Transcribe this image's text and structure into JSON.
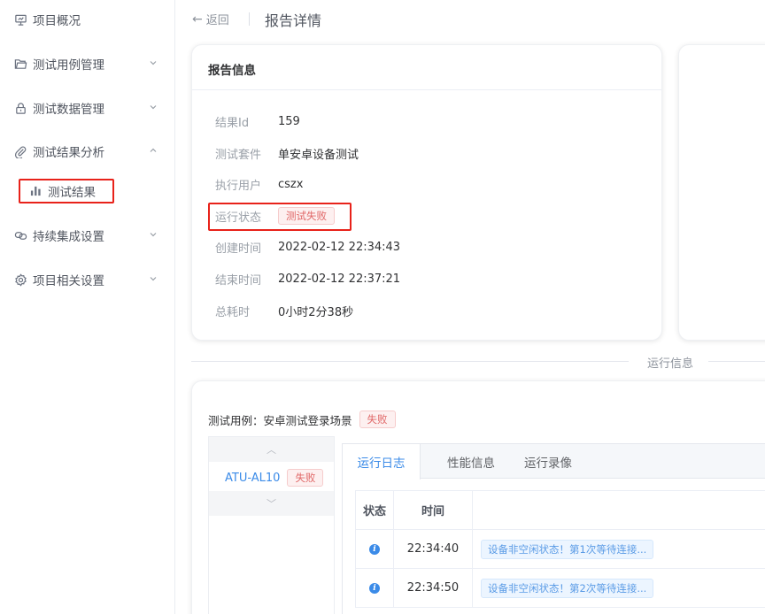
{
  "sidebar": {
    "items": [
      {
        "label": "项目概况",
        "icon": "presentation-icon"
      },
      {
        "label": "测试用例管理",
        "icon": "folder-icon"
      },
      {
        "label": "测试数据管理",
        "icon": "lock-icon"
      },
      {
        "label": "测试结果分析",
        "icon": "paperclip-icon"
      },
      {
        "label": "持续集成设置",
        "icon": "link-icon"
      },
      {
        "label": "项目相关设置",
        "icon": "gear-icon"
      }
    ],
    "sub_item": {
      "label": "测试结果",
      "icon": "bar-chart-icon"
    }
  },
  "header": {
    "back_label": "返回",
    "title": "报告详情"
  },
  "report": {
    "title": "报告信息",
    "fields": {
      "result_id": {
        "label": "结果Id",
        "value": "159"
      },
      "suite": {
        "label": "测试套件",
        "value": "单安卓设备测试"
      },
      "user": {
        "label": "执行用户",
        "value": "cszx"
      },
      "status": {
        "label": "运行状态",
        "value": "测试失败"
      },
      "created": {
        "label": "创建时间",
        "value": "2022-02-12 22:34:43"
      },
      "ended": {
        "label": "结束时间",
        "value": "2022-02-12 22:37:21"
      },
      "duration": {
        "label": "总耗时",
        "value": "0小时2分38秒"
      }
    }
  },
  "run_info": {
    "label": "运行信息",
    "case_title": "测试用例：安卓测试登录场景",
    "case_status": "失败",
    "device": {
      "name": "ATU-AL10",
      "status": "失败"
    },
    "tabs": [
      "运行日志",
      "性能信息",
      "运行录像"
    ],
    "active_tab": "运行日志",
    "table": {
      "headers": [
        "状态",
        "时间",
        ""
      ],
      "rows": [
        {
          "status_icon": "info-icon",
          "time": "22:34:40",
          "message": "设备非空闲状态！第1次等待连接..."
        },
        {
          "status_icon": "info-icon",
          "time": "22:34:50",
          "message": "设备非空闲状态！第2次等待连接..."
        }
      ]
    }
  },
  "colors": {
    "accent": "#3b8be8",
    "fail_text": "#e06666",
    "highlight_box": "#e8221a"
  }
}
